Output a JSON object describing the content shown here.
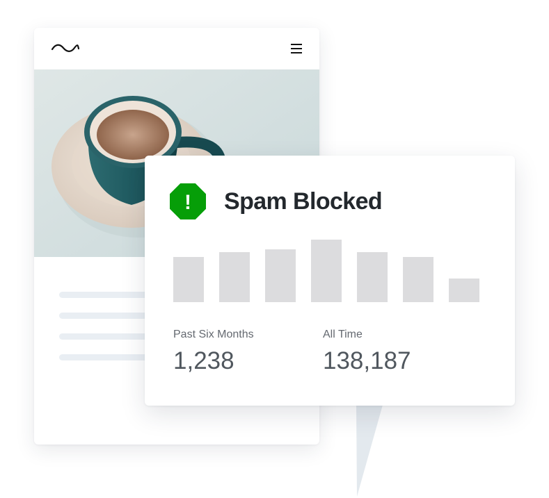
{
  "widget": {
    "title": "Spam Blocked",
    "badge_symbol": "!",
    "badge_color": "#069e08",
    "bar_color": "#dcdcde",
    "bars": [
      0.68,
      0.76,
      0.8,
      0.95,
      0.76,
      0.68,
      0.36
    ],
    "stats": [
      {
        "label": "Past Six Months",
        "value": "1,238"
      },
      {
        "label": "All Time",
        "value": "138,187"
      }
    ]
  },
  "site_preview": {
    "logo_icon": "wave-logo-icon",
    "menu_icon": "hamburger-menu-icon",
    "image": "coffee-cup-photo",
    "text_lines": 4
  }
}
